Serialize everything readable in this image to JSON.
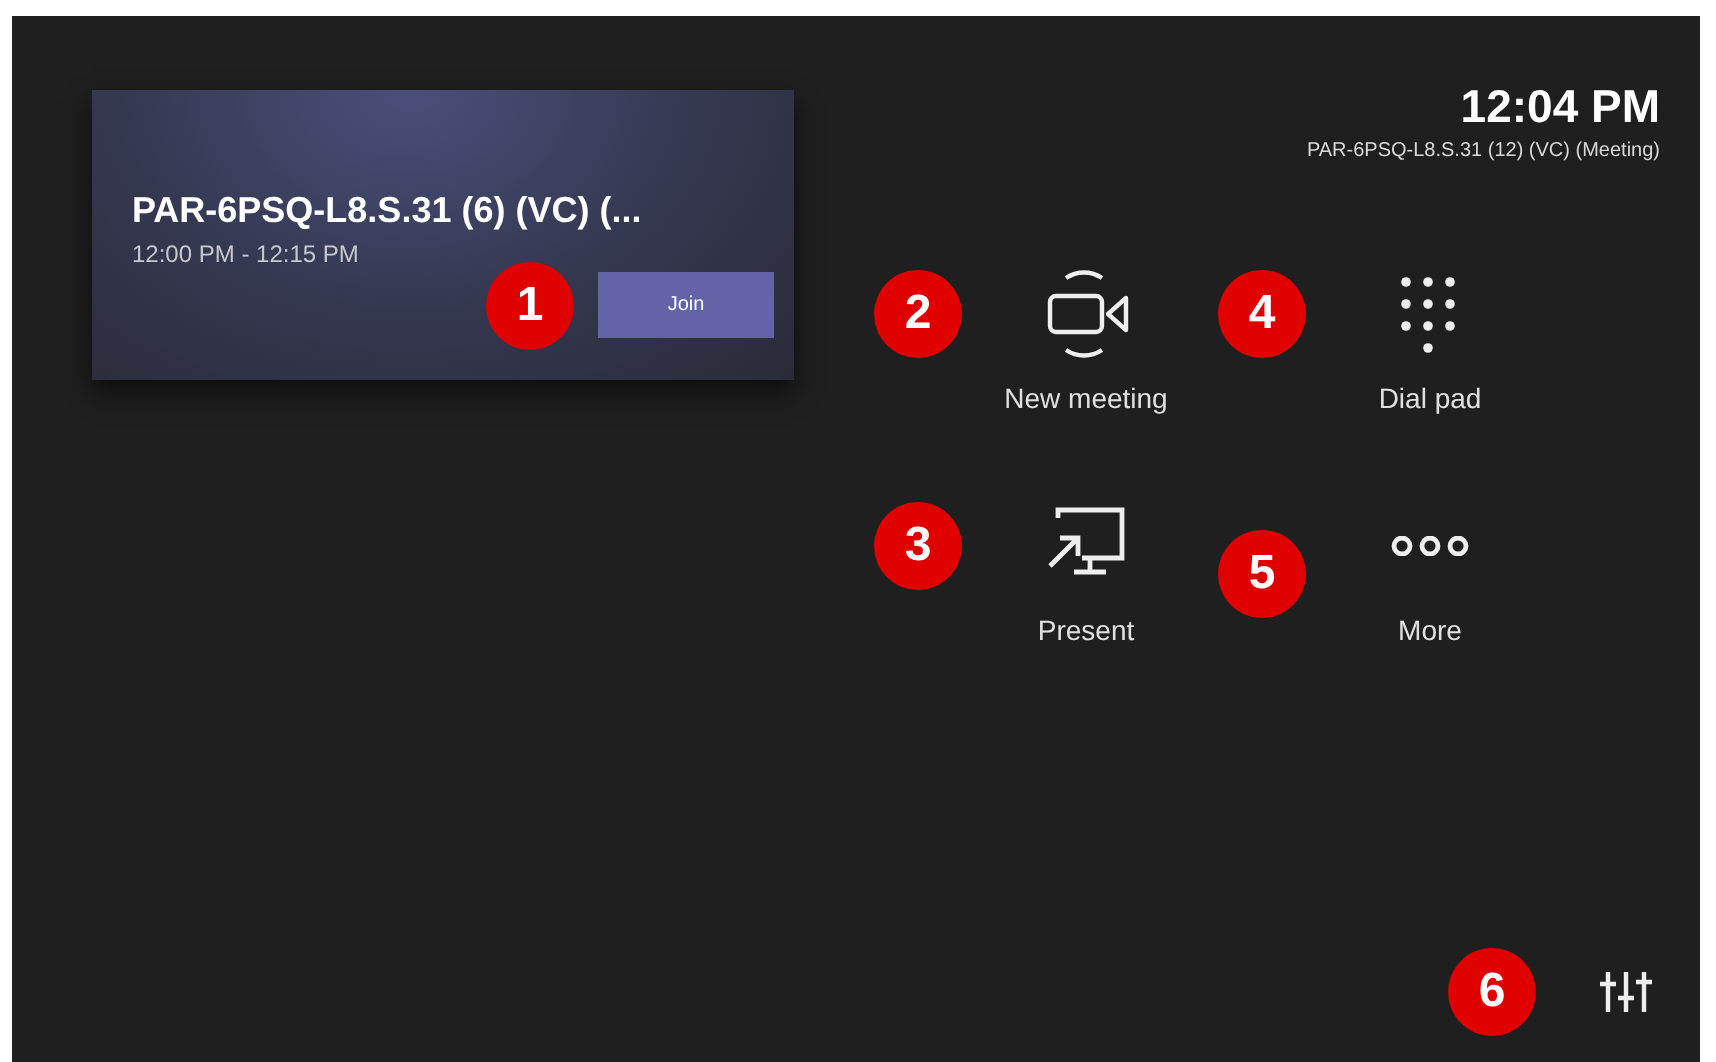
{
  "meeting_card": {
    "title": "PAR-6PSQ-L8.S.31 (6) (VC) (...",
    "time": "12:00 PM - 12:15 PM",
    "join_button": "Join",
    "callout": "1"
  },
  "clock": {
    "time": "12:04 PM",
    "room": "PAR-6PSQ-L8.S.31 (12) (VC) (Meeting)"
  },
  "actions": [
    {
      "kind": "camera",
      "label": "New meeting",
      "callout": "2"
    },
    {
      "kind": "dialpad",
      "label": "Dial pad",
      "callout": "4"
    },
    {
      "kind": "present",
      "label": "Present",
      "callout": "3"
    },
    {
      "kind": "more",
      "label": "More",
      "callout": "5"
    }
  ],
  "settings": {
    "callout": "6"
  }
}
